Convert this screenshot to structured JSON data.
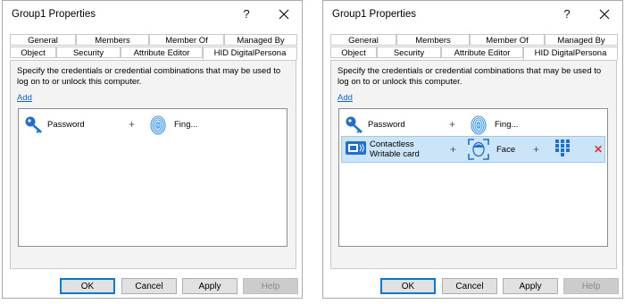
{
  "dialogs": [
    {
      "title": "Group1 Properties",
      "help_symbol": "?",
      "tabs_row1": [
        "General",
        "Members",
        "Member Of",
        "Managed By"
      ],
      "tabs_row2": [
        "Object",
        "Security",
        "Attribute Editor",
        "HID DigitalPersona"
      ],
      "description": "Specify the credentials or credential combinations that may be used to log on to or unlock this computer.",
      "add_link": "Add",
      "rows": [
        {
          "first_label": "Password",
          "second_label": "Fing..."
        }
      ],
      "buttons": {
        "ok": "OK",
        "cancel": "Cancel",
        "apply": "Apply",
        "help": "Help"
      }
    },
    {
      "title": "Group1 Properties",
      "help_symbol": "?",
      "tabs_row1": [
        "General",
        "Members",
        "Member Of",
        "Managed By"
      ],
      "tabs_row2": [
        "Object",
        "Security",
        "Attribute Editor",
        "HID DigitalPersona"
      ],
      "description": "Specify the credentials or credential combinations that may be used to log on to or unlock this computer.",
      "add_link": "Add",
      "rows": [
        {
          "first_label": "Password",
          "second_label": "Fing..."
        },
        {
          "first_label": "Contactless Writable card",
          "first_label_line1": "Contactless",
          "first_label_line2": "Writable card",
          "second_label": "Face",
          "third_icon": "keypad-pin-icon",
          "selected": true
        }
      ],
      "buttons": {
        "ok": "OK",
        "cancel": "Cancel",
        "apply": "Apply",
        "help": "Help"
      }
    }
  ],
  "plus_symbol": "+",
  "delete_symbol": "✕",
  "colors": {
    "link": "#0a64d2",
    "key_icon": "#1f6fd1",
    "selection": "#cce4f7",
    "delete": "#e0322a"
  },
  "icons": [
    "key-icon",
    "fingerprint-icon",
    "contactless-card-icon",
    "face-recognition-icon",
    "keypad-pin-icon",
    "close-icon"
  ]
}
